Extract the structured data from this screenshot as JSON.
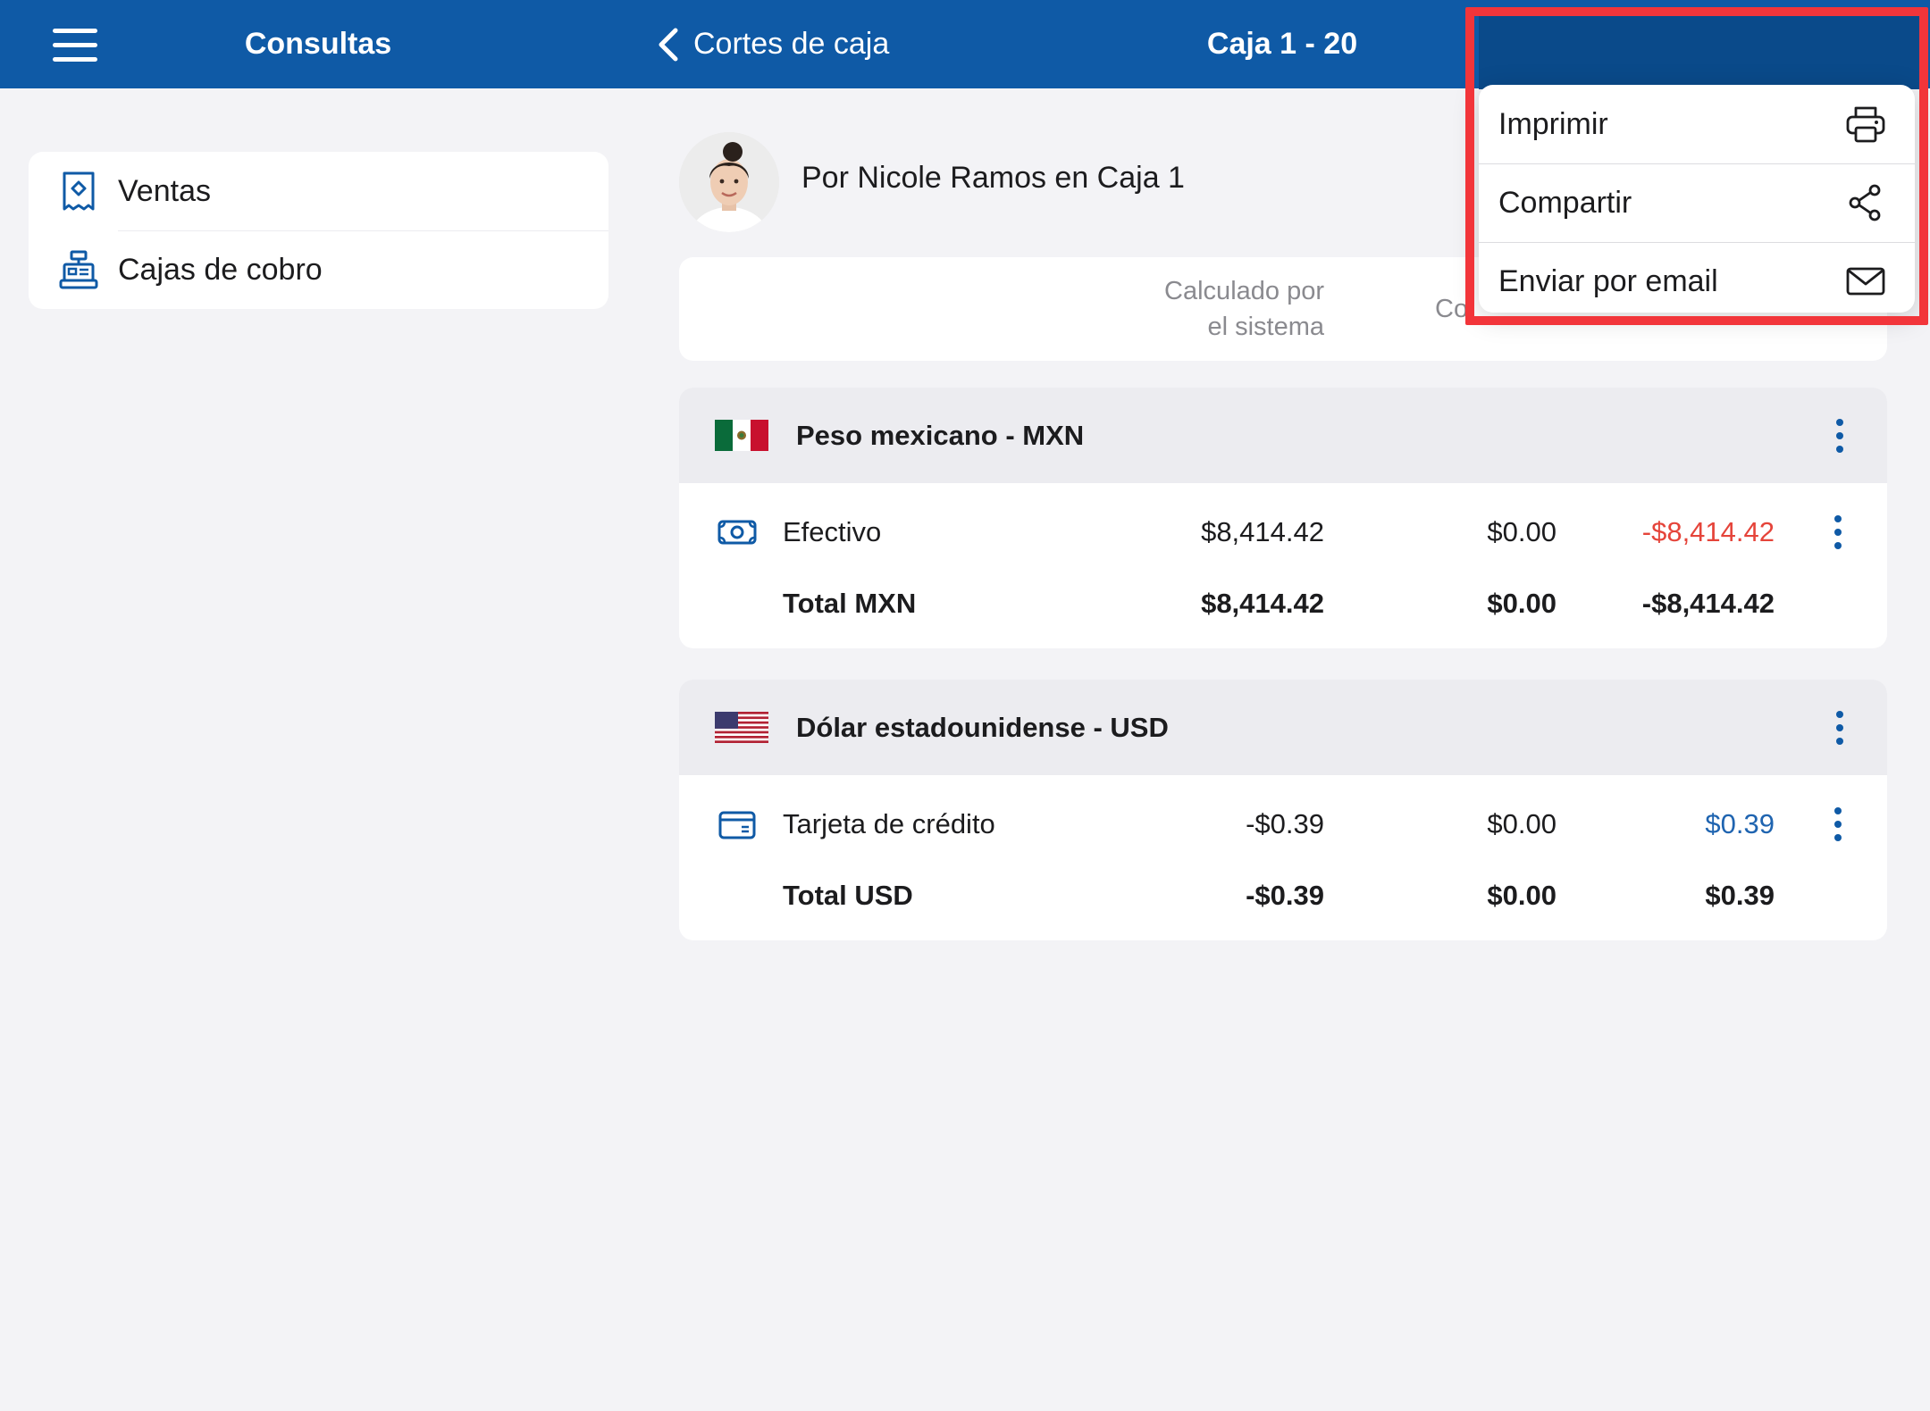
{
  "topbar": {
    "left_title": "Consultas",
    "back_label": "Cortes de caja",
    "center_title": "Caja 1 - 20"
  },
  "sidebar": {
    "items": [
      {
        "label": "Ventas",
        "icon": "receipt-icon"
      },
      {
        "label": "Cajas de cobro",
        "icon": "cash-register-icon"
      }
    ]
  },
  "report": {
    "author_line": "Por Nicole Ramos en Caja 1",
    "columns": {
      "calc_line1": "Calculado por",
      "calc_line2": "el sistema",
      "counted_partial": "Co"
    }
  },
  "sections": [
    {
      "title": "Peso mexicano - MXN",
      "flag": "mexico-flag-icon",
      "rows": [
        {
          "label": "Efectivo",
          "icon": "cash-icon",
          "system": "$8,414.42",
          "counted": "$0.00",
          "diff": "-$8,414.42",
          "diff_color": "#e5443a"
        }
      ],
      "total": {
        "label": "Total MXN",
        "system": "$8,414.42",
        "counted": "$0.00",
        "diff": "-$8,414.42"
      }
    },
    {
      "title": "Dólar estadounidense - USD",
      "flag": "usa-flag-icon",
      "rows": [
        {
          "label": "Tarjeta de crédito",
          "icon": "credit-card-icon",
          "system": "-$0.39",
          "counted": "$0.00",
          "diff": "$0.39",
          "diff_color": "#1f64b0"
        }
      ],
      "total": {
        "label": "Total USD",
        "system": "-$0.39",
        "counted": "$0.00",
        "diff": "$0.39"
      }
    }
  ],
  "menu": {
    "items": [
      {
        "label": "Imprimir",
        "icon": "printer-icon"
      },
      {
        "label": "Compartir",
        "icon": "share-icon"
      },
      {
        "label": "Enviar por email",
        "icon": "mail-icon"
      }
    ]
  },
  "colors": {
    "primary": "#0f5aa6",
    "highlight": "#f2353a",
    "negative": "#e5443a",
    "positive": "#1f64b0"
  }
}
